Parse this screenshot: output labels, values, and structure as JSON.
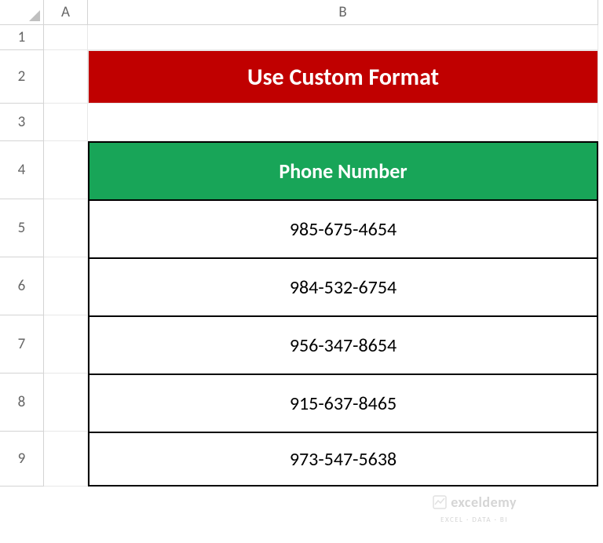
{
  "columns": [
    "A",
    "B"
  ],
  "rows": [
    "1",
    "2",
    "3",
    "4",
    "5",
    "6",
    "7",
    "8",
    "9"
  ],
  "title": "Use Custom Format",
  "table": {
    "header": "Phone Number",
    "data": [
      "985-675-4654",
      "984-532-6754",
      "956-347-8654",
      "915-637-8465",
      "973-547-5638"
    ]
  },
  "watermark": {
    "name": "exceldemy",
    "tagline": "EXCEL · DATA · BI"
  }
}
